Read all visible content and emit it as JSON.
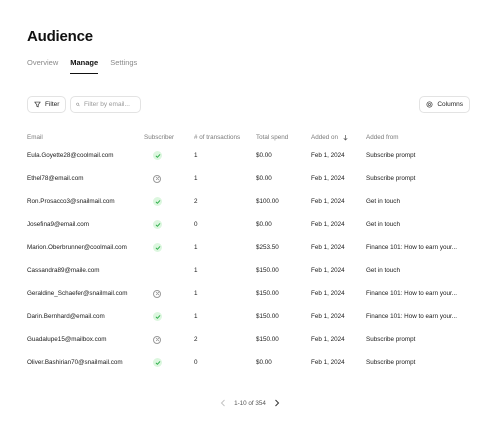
{
  "page": {
    "title": "Audience"
  },
  "tabs": [
    {
      "label": "Overview",
      "active": false
    },
    {
      "label": "Manage",
      "active": true
    },
    {
      "label": "Settings",
      "active": false
    }
  ],
  "toolbar": {
    "filter_label": "Filter",
    "search_placeholder": "Filter by email...",
    "columns_label": "Columns"
  },
  "table": {
    "headers": {
      "email": "Email",
      "subscriber": "Subscriber",
      "transactions": "# of transactions",
      "spend": "Total spend",
      "added_on": "Added on",
      "added_from": "Added from"
    },
    "rows": [
      {
        "email": "Eula.Goyette28@coolmail.com",
        "subscriber": true,
        "transactions": "1",
        "spend": "$0.00",
        "added_on": "Feb 1, 2024",
        "added_from": "Subscribe prompt"
      },
      {
        "email": "Ethel78@email.com",
        "subscriber": false,
        "transactions": "1",
        "spend": "$0.00",
        "added_on": "Feb 1, 2024",
        "added_from": "Subscribe prompt"
      },
      {
        "email": "Ron.Prosacco3@snailmail.com",
        "subscriber": true,
        "transactions": "2",
        "spend": "$100.00",
        "added_on": "Feb 1, 2024",
        "added_from": "Get in touch"
      },
      {
        "email": "Josefina9@email.com",
        "subscriber": true,
        "transactions": "0",
        "spend": "$0.00",
        "added_on": "Feb 1, 2024",
        "added_from": "Get in touch"
      },
      {
        "email": "Marion.Oberbrunner@coolmail.com",
        "subscriber": true,
        "transactions": "1",
        "spend": "$253.50",
        "added_on": "Feb 1, 2024",
        "added_from": "Finance 101: How to earn your..."
      },
      {
        "email": "Cassandra89@maile.com",
        "subscriber": null,
        "transactions": "1",
        "spend": "$150.00",
        "added_on": "Feb 1, 2024",
        "added_from": "Get in touch"
      },
      {
        "email": "Geraldine_Schaefer@snailmail.com",
        "subscriber": false,
        "transactions": "1",
        "spend": "$150.00",
        "added_on": "Feb 1, 2024",
        "added_from": "Finance 101: How to earn your..."
      },
      {
        "email": "Darin.Bernhard@email.com",
        "subscriber": true,
        "transactions": "1",
        "spend": "$150.00",
        "added_on": "Feb 1, 2024",
        "added_from": "Finance 101: How to earn your..."
      },
      {
        "email": "Guadalupe15@mailbox.com",
        "subscriber": false,
        "transactions": "2",
        "spend": "$150.00",
        "added_on": "Feb 1, 2024",
        "added_from": "Subscribe prompt"
      },
      {
        "email": "Oliver.Bashirian70@snailmail.com",
        "subscriber": true,
        "transactions": "0",
        "spend": "$0.00",
        "added_on": "Feb 1, 2024",
        "added_from": "Subscribe prompt"
      }
    ]
  },
  "pagination": {
    "text": "1-10 of 354"
  },
  "colors": {
    "check_bg": "#dcf7df",
    "check_fg": "#2fae4b",
    "muted": "#7a7a7a"
  }
}
